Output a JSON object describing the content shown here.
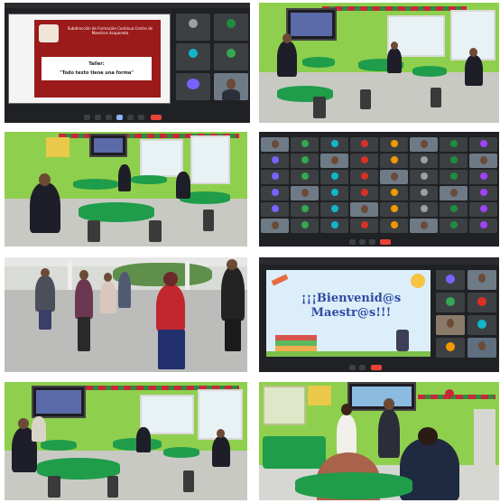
{
  "collage": {
    "tiles": [
      {
        "id": "video-call-presentation"
      },
      {
        "id": "classroom-photo-1"
      },
      {
        "id": "classroom-photo-2"
      },
      {
        "id": "video-call-grid"
      },
      {
        "id": "courtyard-photo"
      },
      {
        "id": "video-call-welcome"
      },
      {
        "id": "classroom-photo-3"
      },
      {
        "id": "classroom-photo-4"
      }
    ]
  },
  "slide1": {
    "title": "Subdirección de Formación Continua Centro de Maestros Acaponeta",
    "taller_label": "Taller:",
    "taller_name": "\"Todo texto tiene una forma\""
  },
  "slide2": {
    "welcome": "¡¡¡Bienvenid@s Maestr@s!!!"
  },
  "colors": {
    "classroom_green": "#8fcf4e",
    "table_green": "#1f9d4a",
    "call_bg": "#202124",
    "end_call_red": "#ea4335",
    "slide_red": "#9b1b1b"
  }
}
